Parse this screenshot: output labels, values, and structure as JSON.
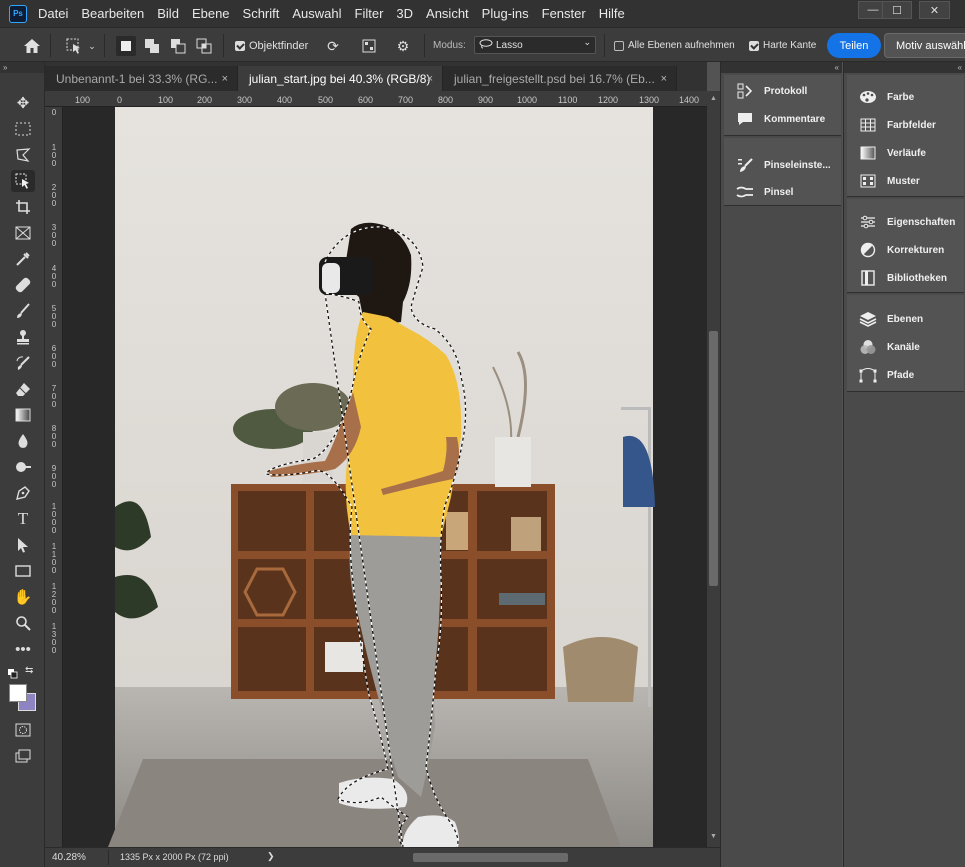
{
  "menubar": {
    "logo": "Ps",
    "items": [
      "Datei",
      "Bearbeiten",
      "Bild",
      "Ebene",
      "Schrift",
      "Auswahl",
      "Filter",
      "3D",
      "Ansicht",
      "Plug-ins",
      "Fenster",
      "Hilfe"
    ],
    "window_buttons": {
      "minimize": "—",
      "maximize": "☐",
      "close": "✕"
    }
  },
  "options": {
    "object_finder": "Objektfinder",
    "mode_label": "Modus:",
    "mode_value": "Lasso",
    "all_layers": "Alle Ebenen aufnehmen",
    "hard_edge": "Harte Kante",
    "share": "Teilen",
    "select_subject": "Motiv auswählen"
  },
  "collapse_glyph": "»",
  "tabs": [
    {
      "label": "Unbenannt-1 bei 33.3% (RG...",
      "close": "×"
    },
    {
      "label": "julian_start.jpg bei 40.3% (RGB/8)",
      "close": "×"
    },
    {
      "label": "julian_freigestellt.psd bei 16.7% (Eb...",
      "close": "×"
    }
  ],
  "ruler_h": [
    "100",
    "0",
    "100",
    "200",
    "300",
    "400",
    "500",
    "600",
    "700",
    "800",
    "900",
    "1000",
    "1100",
    "1200",
    "1300",
    "1400"
  ],
  "ruler_v": [
    [
      "0"
    ],
    [
      "1",
      "0",
      "0"
    ],
    [
      "2",
      "0",
      "0"
    ],
    [
      "3",
      "0",
      "0"
    ],
    [
      "4",
      "0",
      "0"
    ],
    [
      "5",
      "0",
      "0"
    ],
    [
      "6",
      "0",
      "0"
    ],
    [
      "7",
      "0",
      "0"
    ],
    [
      "8",
      "0",
      "0"
    ],
    [
      "9",
      "0",
      "0"
    ],
    [
      "1",
      "0",
      "0",
      "0"
    ],
    [
      "1",
      "1",
      "0",
      "0"
    ],
    [
      "1",
      "2",
      "0",
      "0"
    ],
    [
      "1",
      "3",
      "0",
      "0"
    ]
  ],
  "status": {
    "zoom": "40.28%",
    "doc_size": "1335 Px x 2000 Px (72 ppi)",
    "arrow": "❯"
  },
  "panels_left": [
    [
      {
        "label": "Protokoll",
        "icon": "history-icon"
      },
      {
        "label": "Kommentare",
        "icon": "comment-icon"
      }
    ],
    [
      {
        "label": "Pinseleinste...",
        "icon": "brush-settings-icon"
      },
      {
        "label": "Pinsel",
        "icon": "brush-icon"
      }
    ]
  ],
  "panels_right": [
    [
      {
        "label": "Farbe",
        "icon": "palette-icon"
      },
      {
        "label": "Farbfelder",
        "icon": "swatches-icon"
      },
      {
        "label": "Verläufe",
        "icon": "gradient-icon"
      },
      {
        "label": "Muster",
        "icon": "pattern-icon"
      }
    ],
    [
      {
        "label": "Eigenschaften",
        "icon": "properties-icon"
      },
      {
        "label": "Korrekturen",
        "icon": "adjustments-icon"
      },
      {
        "label": "Bibliotheken",
        "icon": "libraries-icon"
      }
    ],
    [
      {
        "label": "Ebenen",
        "icon": "layers-icon"
      },
      {
        "label": "Kanäle",
        "icon": "channels-icon"
      },
      {
        "label": "Pfade",
        "icon": "paths-icon"
      }
    ]
  ],
  "colors": {
    "accent": "#1473e6",
    "foreground": "#ffffff",
    "background": "#8e84c4"
  }
}
